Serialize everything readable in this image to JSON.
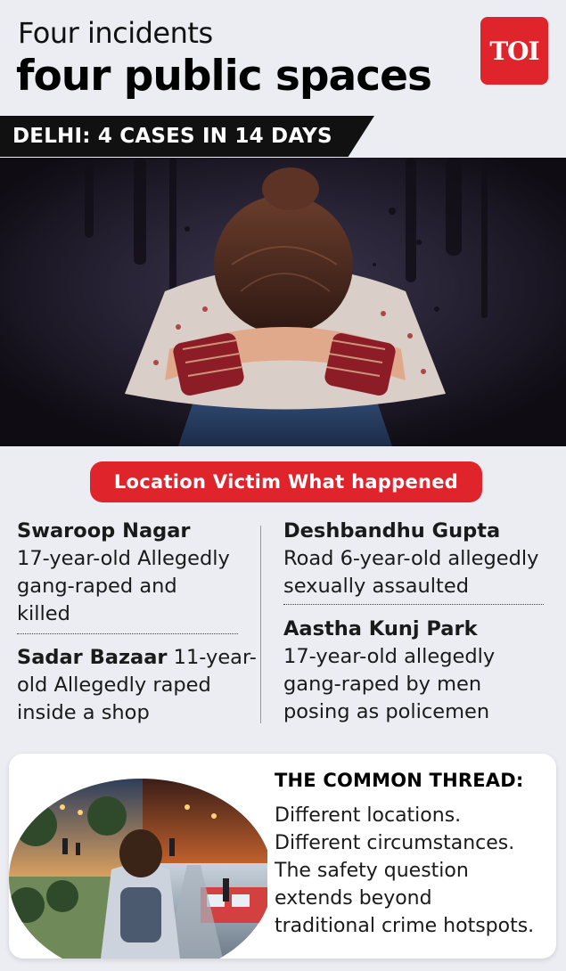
{
  "header": {
    "title_line1": "Four incidents",
    "title_line2": "four public spaces",
    "logo_text": "TOI"
  },
  "banner": {
    "text": "DELHI: 4 CASES IN 14 DAYS"
  },
  "table_header": {
    "text": "Location Victim What happened"
  },
  "cases": [
    {
      "location": "Swaroop Nagar",
      "lines": [
        "17-year-old Allegedly",
        "gang-raped and",
        "killed"
      ]
    },
    {
      "location": "Sadar Bazaar",
      "inline_rest": " 11-year-",
      "lines": [
        "old Allegedly raped",
        "inside a shop"
      ]
    },
    {
      "location": "Deshbandhu Gupta",
      "lines": [
        "Road 6-year-old allegedly",
        "sexually assaulted"
      ]
    },
    {
      "location": "Aastha Kunj Park",
      "lines": [
        "17-year-old allegedly",
        "gang-raped by men",
        "posing as policemen"
      ]
    }
  ],
  "common_thread": {
    "heading": "THE COMMON THREAD:",
    "lines": [
      "Different locations.",
      "Different circumstances.",
      "The safety question",
      "extends beyond",
      "traditional crime hotspots."
    ]
  },
  "colors": {
    "accent": "#e0242b",
    "background": "#ecedf3",
    "banner": "#111111"
  }
}
